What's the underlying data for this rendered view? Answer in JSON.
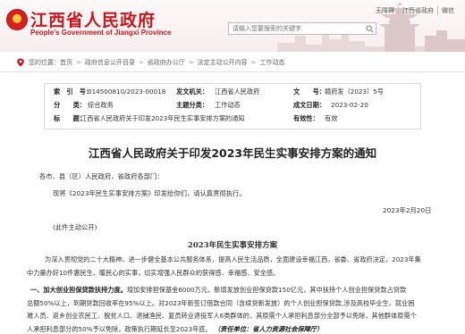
{
  "header": {
    "site_title": "江西省人民政府",
    "site_subtitle": "People's Government of Jiangxi Province",
    "top_links": [
      "无障碍",
      "江西省政府",
      "微信"
    ],
    "search_placeholder": "请输入您要搜索的关键字",
    "brand_color": "#c8161d"
  },
  "breadcrumb": {
    "location_label": "您的位置：",
    "items": [
      "首页",
      "政府信息公开目录",
      "省政府办公厅",
      "法定主动公开内容",
      "工作动态"
    ]
  },
  "info": {
    "index_label": "索　引　号：",
    "index_value": "014500810/2023-00018",
    "issuer_label": "发文机关：",
    "issuer_value": "江西省人民政府",
    "doc_no_label": "文　　号：",
    "doc_no_value": "赣府发〔2023〕5号",
    "category_label": "分　　类：",
    "category_value": "综合政务",
    "topic_label": "主题分类：",
    "topic_value": "工作动态",
    "date_label": "成文日期：",
    "date_value": "2023-02-20",
    "title_label": "标　　题：",
    "title_value": "江西省人民政府关于印发2023年民生实事安排方案的通知",
    "validity_label": "有效性：",
    "validity_value": "有效"
  },
  "article": {
    "title": "江西省人民政府关于印发2023年民生实事安排方案的通知",
    "salutation": "各市、县（区）人民政府，省政府各部门：",
    "body1": "现将《2023年民生实事安排方案》印发给你们，请认真贯彻执行。",
    "signature_date": "2023年2月20日",
    "public_note": "(此件主动公开)",
    "section_title": "2023年民生实事安排方案",
    "intro_line1": "为深入贯彻党的二十大精神，进一步健全基本公共服务体系，提高人民生活品质，全面建设幸福江西，省委、省政府决定，2023年集",
    "intro_line2": "中力量办好10件惠民生、暖民心的实事，切实增强人民群众的获得感、幸福感、安全感。",
    "item1_heading": "一、加大创业担保贷款扶持力度。",
    "item1_line1": "增加安排担保基金6000万元，新增发放创业担保贷款150亿元，其中扶持个人创业担保贷款占贷款",
    "item1_line2": "总额50%以上，到期贷款回收率在95%以上。对2023年新签订借款合同（含续贷新发放）的个人创业担保贷款,涉及高校毕业生、就业困",
    "item1_line3": "难人员、返乡创业农民工、脱贫人口、退捕渔民、复员转业退役军人6类群体的，其原需个人承担利息部分全部予以免除，其他群体原需个",
    "item1_line4": "人承担利息部分的50%予以免除，政策执行期延长至2023年底。",
    "item1_source": "（责任单位：省人力资源社会保障厅）"
  }
}
